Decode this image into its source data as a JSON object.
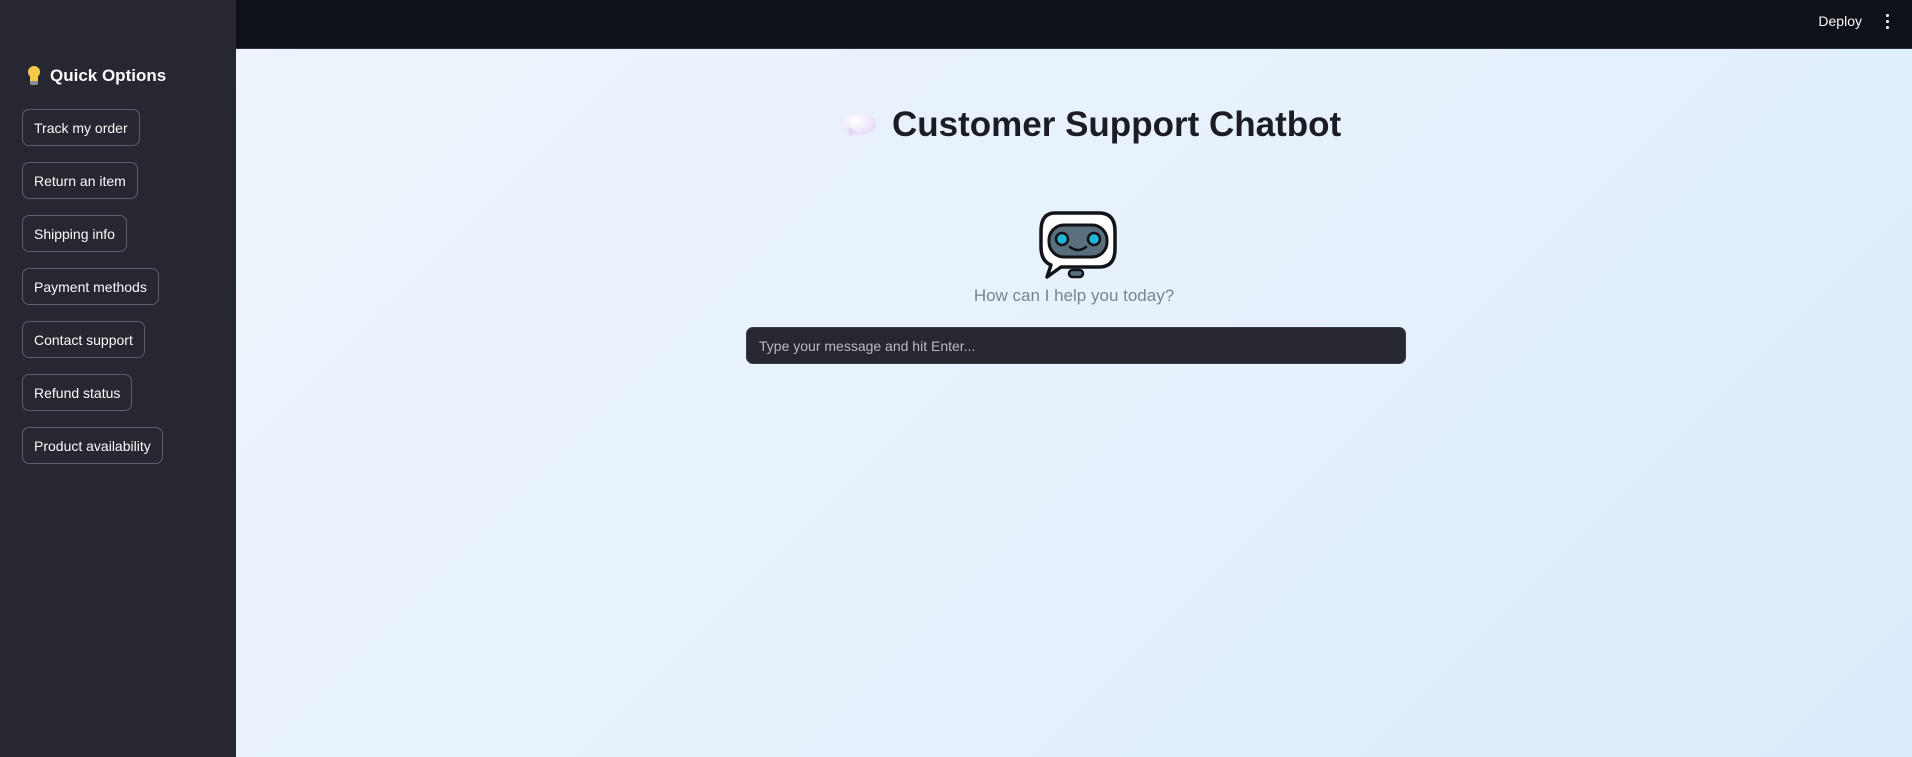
{
  "header": {
    "deploy_label": "Deploy",
    "menu_icon": "kebab-menu-icon"
  },
  "sidebar": {
    "title": "Quick Options",
    "title_icon": "lightbulb-icon",
    "buttons": [
      {
        "label": "Track my order"
      },
      {
        "label": "Return an item"
      },
      {
        "label": "Shipping info"
      },
      {
        "label": "Payment methods"
      },
      {
        "label": "Contact support"
      },
      {
        "label": "Refund status"
      },
      {
        "label": "Product availability"
      }
    ]
  },
  "main": {
    "title": "Customer Support Chatbot",
    "title_icon": "speech-bubble-icon",
    "hero_icon": "robot-icon",
    "prompt": "How can I help you today?",
    "input_placeholder": "Type your message and hit Enter..."
  },
  "colors": {
    "header_bg": "#0e1117",
    "sidebar_bg": "#262730",
    "main_bg": "#eaf2fb",
    "title_text": "#1c1d24",
    "robot_eye": "#1fb6d8"
  }
}
